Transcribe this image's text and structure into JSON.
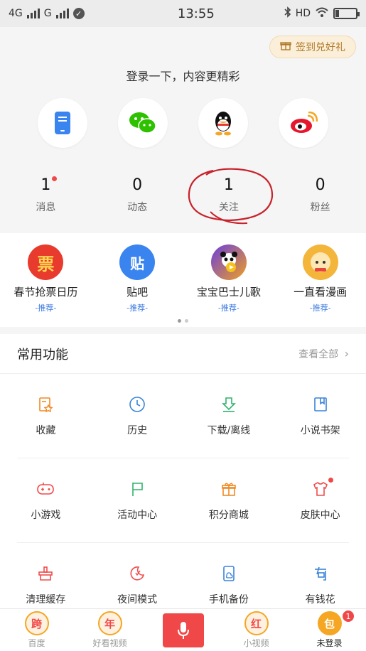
{
  "status_bar": {
    "network1": "4G",
    "network2": "G",
    "time": "13:55",
    "hd": "HD",
    "icons": [
      "signal-icon",
      "check-icon",
      "bluetooth-icon",
      "wifi-icon",
      "battery-icon"
    ]
  },
  "header": {
    "signin_label": "签到兑好礼",
    "login_prompt": "登录一下，内容更精彩",
    "login_methods": [
      "phone-icon",
      "wechat-icon",
      "qq-icon",
      "weibo-icon"
    ],
    "stats": [
      {
        "value": "1",
        "label": "消息",
        "dot": true
      },
      {
        "value": "0",
        "label": "动态",
        "dot": false
      },
      {
        "value": "1",
        "label": "关注",
        "dot": false
      },
      {
        "value": "0",
        "label": "粉丝",
        "dot": false
      }
    ]
  },
  "recommend": {
    "items": [
      {
        "name": "春节抢票日历",
        "tag": "-推荐-",
        "icon_text": "票",
        "color": "#e83b2e"
      },
      {
        "name": "贴吧",
        "tag": "-推荐-",
        "icon_text": "贴",
        "color": "#3a84f0"
      },
      {
        "name": "宝宝巴士儿歌",
        "tag": "-推荐-",
        "icon_text": "",
        "color": "#7b4fe0"
      },
      {
        "name": "一直看漫画",
        "tag": "-推荐-",
        "icon_text": "",
        "color": "#f3b53a"
      }
    ],
    "page_count": 2,
    "active_page": 0
  },
  "common": {
    "title": "常用功能",
    "more": "查看全部",
    "items": [
      {
        "label": "收藏",
        "icon": "favorite-icon",
        "color": "#f08a24"
      },
      {
        "label": "历史",
        "icon": "clock-icon",
        "color": "#3a84d8"
      },
      {
        "label": "下载/离线",
        "icon": "download-icon",
        "color": "#2fb36a"
      },
      {
        "label": "小说书架",
        "icon": "bookmark-icon",
        "color": "#3a84d8"
      },
      {
        "label": "小游戏",
        "icon": "gamepad-icon",
        "color": "#ef4c4c"
      },
      {
        "label": "活动中心",
        "icon": "flag-icon",
        "color": "#2fb36a"
      },
      {
        "label": "积分商城",
        "icon": "gift-icon",
        "color": "#f08a24"
      },
      {
        "label": "皮肤中心",
        "icon": "shirt-icon",
        "color": "#ef4c4c",
        "dot": true
      },
      {
        "label": "清理缓存",
        "icon": "broom-icon",
        "color": "#ef4c4c"
      },
      {
        "label": "夜间模式",
        "icon": "moon-icon",
        "color": "#ef4c4c"
      },
      {
        "label": "手机备份",
        "icon": "phone-backup-icon",
        "color": "#3a84d8"
      },
      {
        "label": "有钱花",
        "icon": "money-icon",
        "color": "#3a84d8"
      }
    ]
  },
  "tabbar": {
    "tabs": [
      {
        "label": "百度",
        "icon_text": "跨",
        "color": "#f04848"
      },
      {
        "label": "好看视频",
        "icon_text": "年",
        "color": "#f04848"
      },
      {
        "label": "",
        "icon": "mic-icon"
      },
      {
        "label": "小视频",
        "icon_text": "红",
        "color": "#f04848"
      },
      {
        "label": "未登录",
        "icon_text": "包",
        "color": "#f04848",
        "badge": "1"
      }
    ]
  }
}
